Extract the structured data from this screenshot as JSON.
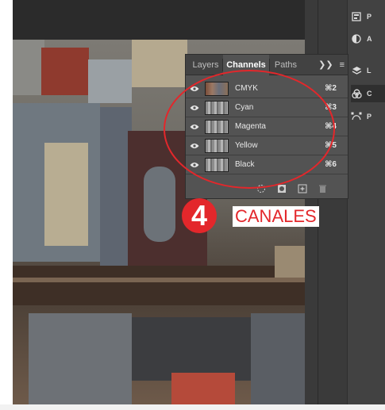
{
  "panel": {
    "tabs": [
      {
        "label": "Layers",
        "active": false
      },
      {
        "label": "Channels",
        "active": true
      },
      {
        "label": "Paths",
        "active": false
      }
    ],
    "channels": [
      {
        "name": "CMYK",
        "shortcut": "⌘2",
        "visible": true
      },
      {
        "name": "Cyan",
        "shortcut": "⌘3",
        "visible": true
      },
      {
        "name": "Magenta",
        "shortcut": "⌘4",
        "visible": true
      },
      {
        "name": "Yellow",
        "shortcut": "⌘5",
        "visible": true
      },
      {
        "name": "Black",
        "shortcut": "⌘6",
        "visible": true
      }
    ],
    "footer_icons": [
      "load-selection-icon",
      "save-selection-icon",
      "new-channel-icon",
      "delete-channel-icon"
    ]
  },
  "dock": {
    "items": [
      {
        "label": "P",
        "icon": "properties-icon",
        "active": false
      },
      {
        "label": "A",
        "icon": "adjustments-icon",
        "active": false
      },
      {
        "label": "L",
        "icon": "layers-icon",
        "active": false
      },
      {
        "label": "C",
        "icon": "channels-icon",
        "active": true
      },
      {
        "label": "P",
        "icon": "paths-icon",
        "active": false
      }
    ]
  },
  "annotation": {
    "step_number": "4",
    "caption": "CANALES",
    "accent_color": "#e3272b"
  }
}
